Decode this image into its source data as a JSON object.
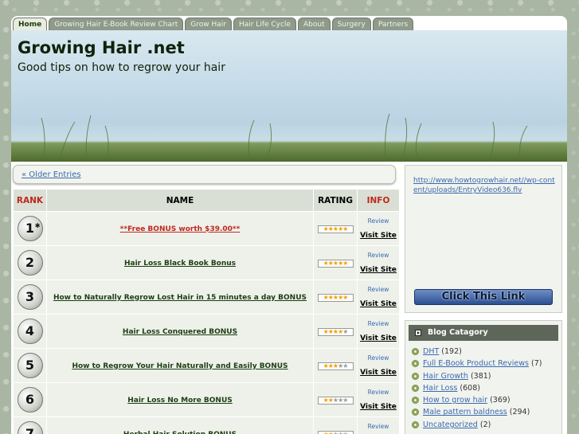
{
  "nav": [
    "Home",
    "Growing Hair E-Book Review Chart",
    "Grow Hair",
    "Hair Life Cycle",
    "About",
    "Surgery",
    "Partners"
  ],
  "header": {
    "title": "Growing Hair .net",
    "tagline": "Good tips on how to regrow your hair"
  },
  "older_link": "« Older Entries",
  "table": {
    "headers": {
      "rank": "RANK",
      "name": "NAME",
      "rating": "RATING",
      "info": "INFO"
    },
    "review_label": "Review",
    "visit_label": "Visit Site",
    "rows": [
      {
        "rank": "1",
        "name": "**Free BONUS worth $39.00**",
        "stars": 5,
        "star": true
      },
      {
        "rank": "2",
        "name": "Hair Loss Black Book Bonus",
        "stars": 5
      },
      {
        "rank": "3",
        "name": "How to Naturally Regrow Lost Hair in 15 minutes a day BONUS",
        "stars": 5
      },
      {
        "rank": "4",
        "name": "Hair Loss Conquered BONUS",
        "stars": 4
      },
      {
        "rank": "5",
        "name": "How to Regrow Your Hair Naturally and Easily BONUS",
        "stars": 2.5
      },
      {
        "rank": "6",
        "name": "Hair Loss No More BONUS",
        "stars": 2
      },
      {
        "rank": "7",
        "name": "Herbal Hair Solution BONUS",
        "stars": 2
      }
    ]
  },
  "sidebar": {
    "video_link": "http://www.howtogrowhair.net//wp-content/uploads/EntryVideo636.flv",
    "click_label": "Click This Link",
    "cat_title": "Blog Catagory",
    "categories": [
      {
        "name": "DHT",
        "count": "(192)"
      },
      {
        "name": "Full E-Book Product Reviews",
        "count": "(7)"
      },
      {
        "name": "Hair Growth",
        "count": "(381)"
      },
      {
        "name": "Hair Loss",
        "count": "(608)"
      },
      {
        "name": "How to grow hair",
        "count": "(369)"
      },
      {
        "name": "Male pattern baldness",
        "count": "(294)"
      },
      {
        "name": "Uncategorized",
        "count": "(2)"
      }
    ]
  },
  "colors": {
    "accent_red": "#c0281d",
    "link_blue": "#3a6ab0"
  }
}
